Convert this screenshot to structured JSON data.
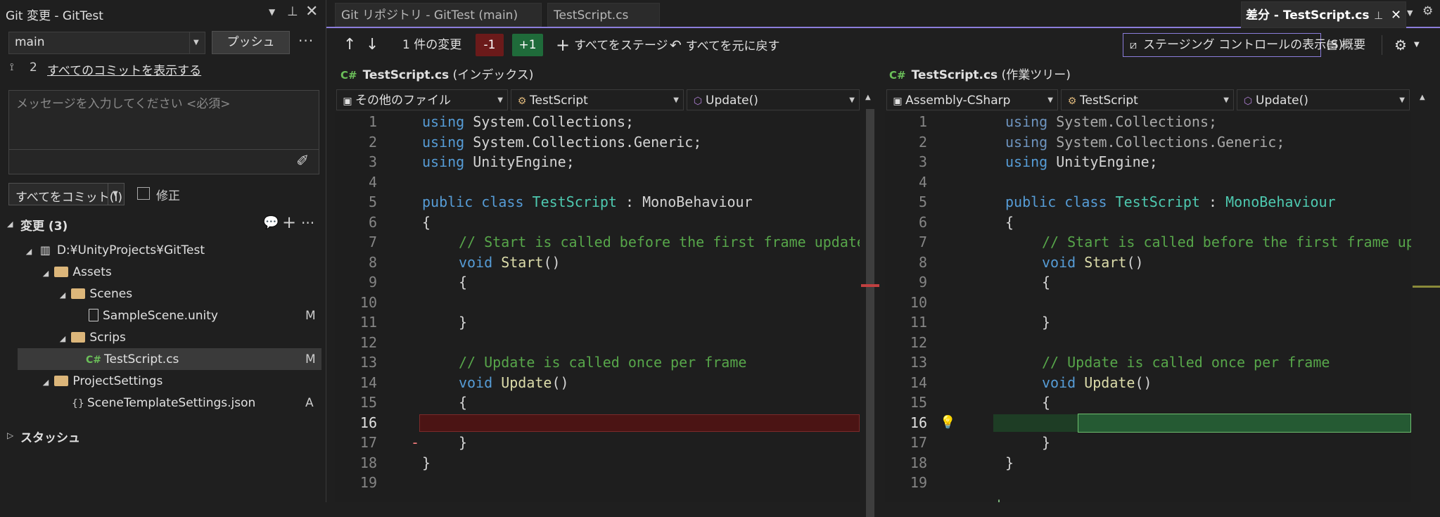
{
  "left": {
    "title": "Git 変更 - GitTest",
    "branch": "main",
    "push_label": "プッシュ",
    "commit_count": "2",
    "show_all_commits": "すべてのコミットを表示する",
    "message_placeholder": "メッセージを入力してください <必須>",
    "commit_all_label": "すべてをコミット(I)",
    "amend_label": "修正",
    "changes_header": "変更 (3)",
    "tree": [
      {
        "label": "D:¥UnityProjects¥GitTest",
        "status": ""
      },
      {
        "label": "Assets",
        "status": ""
      },
      {
        "label": "Scenes",
        "status": ""
      },
      {
        "label": "SampleScene.unity",
        "status": "M"
      },
      {
        "label": "Scrips",
        "status": ""
      },
      {
        "label": "TestScript.cs",
        "status": "M"
      },
      {
        "label": "ProjectSettings",
        "status": ""
      },
      {
        "label": "SceneTemplateSettings.json",
        "status": "A"
      }
    ],
    "stash_label": "スタッシュ"
  },
  "tabs": {
    "repo": "Git リポジトリ - GitTest (main)",
    "file": "TestScript.cs",
    "diff": "差分 - TestScript.cs"
  },
  "toolbar": {
    "change_count": "1 件の変更",
    "removed": "-1",
    "added": "+1",
    "stage_all": "すべてをステージ",
    "revert_all": "すべてを元に戻す",
    "staging_controls": "ステージング コントロールの表示(S)",
    "overview": "概要"
  },
  "left_pane": {
    "file": "TestScript.cs",
    "kind": "(インデックス)",
    "combo_project": "その他のファイル",
    "combo_class": "TestScript",
    "combo_member": "Update()"
  },
  "right_pane": {
    "file": "TestScript.cs",
    "kind": "(作業ツリー)",
    "combo_project": "Assembly-CSharp",
    "combo_class": "TestScript",
    "combo_member": "Update()"
  },
  "colors": {
    "accent": "#8b7ddb",
    "removed_bg": "#4b1414",
    "added_bg": "#1e4d2b"
  }
}
